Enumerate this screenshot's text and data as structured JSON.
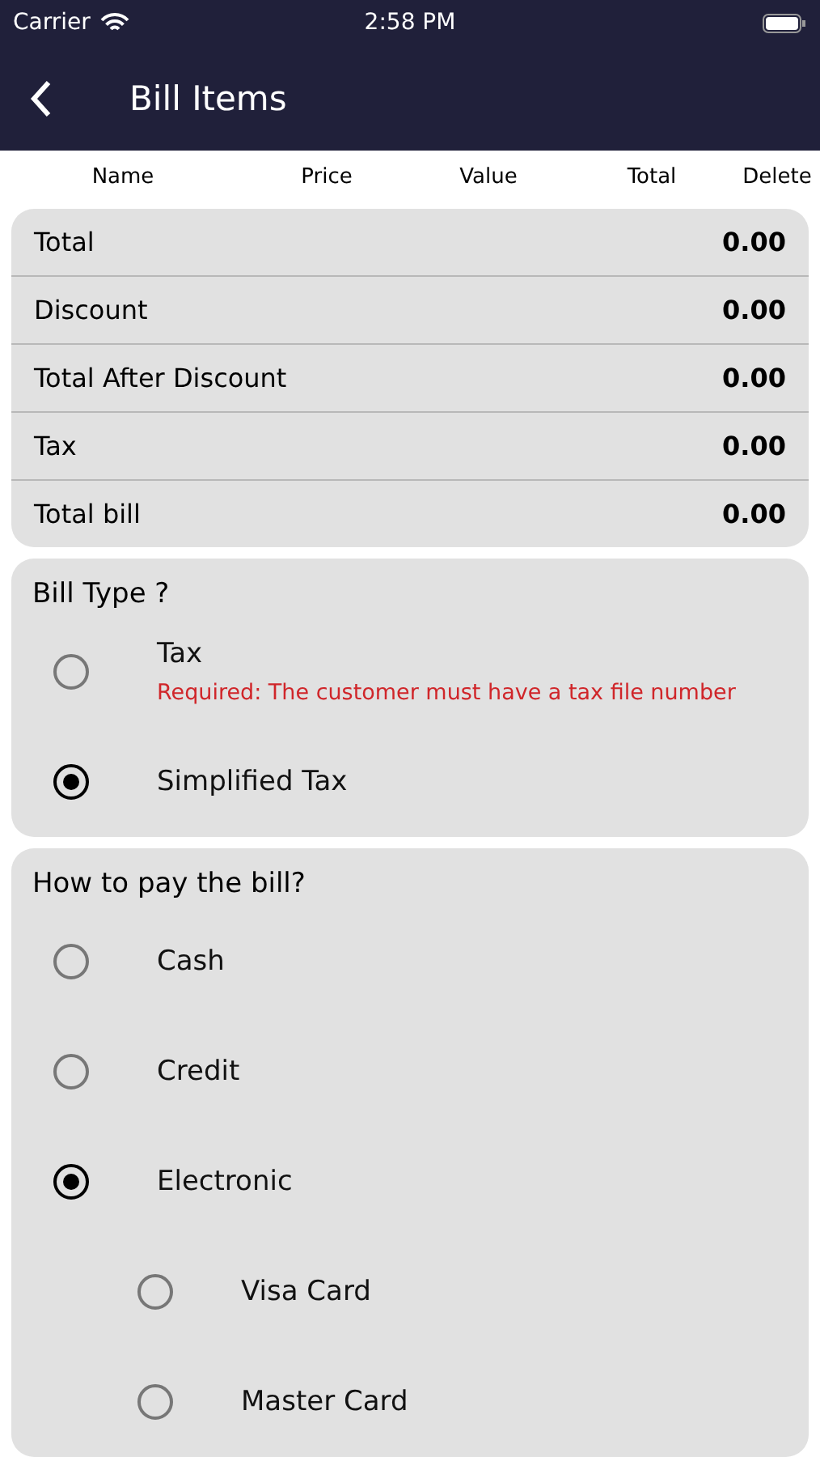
{
  "status_bar": {
    "carrier": "Carrier",
    "time": "2:58 PM"
  },
  "nav": {
    "title": "Bill Items"
  },
  "table": {
    "columns": [
      "Name",
      "Price",
      "Value",
      "Total",
      "Delete"
    ]
  },
  "totals": [
    {
      "label": "Total",
      "value": "0.00"
    },
    {
      "label": "Discount",
      "value": "0.00"
    },
    {
      "label": "Total After Discount",
      "value": "0.00"
    },
    {
      "label": "Tax",
      "value": "0.00"
    },
    {
      "label": "Total bill",
      "value": "0.00"
    }
  ],
  "bill_type": {
    "title": "Bill Type ?",
    "options": [
      {
        "label": "Tax",
        "note": "Required: The customer must have a tax file number",
        "selected": false
      },
      {
        "label": "Simplified Tax",
        "selected": true
      }
    ]
  },
  "payment": {
    "title": "How to pay the bill?",
    "options": [
      {
        "label": "Cash",
        "selected": false
      },
      {
        "label": "Credit",
        "selected": false
      },
      {
        "label": "Electronic",
        "selected": true,
        "children": [
          {
            "label": "Visa Card",
            "selected": false
          },
          {
            "label": "Master Card",
            "selected": false
          }
        ]
      }
    ]
  }
}
